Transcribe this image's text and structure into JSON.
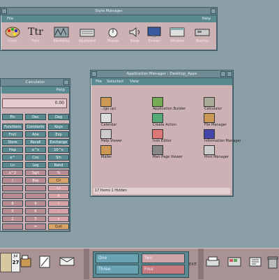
{
  "style_manager": {
    "title": "Style Manager",
    "menu": {
      "left": "File",
      "right": "Help"
    },
    "icons": [
      {
        "label": "Color",
        "icon": "palette-icon"
      },
      {
        "label": "Font",
        "icon": "font-icon"
      },
      {
        "label": "Backdrop",
        "icon": "backdrop-icon"
      },
      {
        "label": "Keyboard",
        "icon": "keyboard-icon"
      },
      {
        "label": "Mouse",
        "icon": "mouse-icon"
      },
      {
        "label": "Beep",
        "icon": "beep-icon"
      },
      {
        "label": "Screen",
        "icon": "screen-icon"
      },
      {
        "label": "Window",
        "icon": "window-icon"
      },
      {
        "label": "Startup",
        "icon": "startup-icon"
      }
    ],
    "font_glyph": "Ttr"
  },
  "calculator": {
    "title": "Calculator",
    "menu_help": "Help",
    "display": "0.00",
    "mode_row": [
      "Fin",
      "Dec",
      "Deg"
    ],
    "rows": [
      [
        "Functions",
        "Constants",
        "Keys"
      ],
      [
        "Fnct",
        "Ahe",
        "Exp"
      ],
      [
        "Store",
        "Recall",
        "Exchange"
      ],
      [
        "Hop",
        "e^x",
        "10^x"
      ],
      [
        "e^",
        "Cos",
        "Sin"
      ],
      [
        "Ln",
        "Log",
        "Rand"
      ],
      [
        "x^2",
        "Sqrt",
        "%"
      ],
      [
        ")",
        "Bsp",
        "Clr"
      ],
      [
        "",
        "",
        "+/-"
      ],
      [
        "",
        "",
        "X"
      ],
      [
        "8",
        "9",
        "/"
      ],
      [
        "5",
        "6",
        "-"
      ],
      [
        "2",
        "3",
        "+"
      ],
      [
        "",
        "=",
        "Quit"
      ]
    ]
  },
  "app_manager": {
    "title": "Application Manager - Desktop_Apps",
    "menu": [
      "File",
      "Selected",
      "View"
    ],
    "items": [
      {
        "label": "..(go up)",
        "icon": "folder-up-icon"
      },
      {
        "label": "Application Builder",
        "icon": "app-builder-icon"
      },
      {
        "label": "Calculator",
        "icon": "calculator-icon"
      },
      {
        "label": "Calendar",
        "icon": "calendar-icon"
      },
      {
        "label": "Create Action",
        "icon": "create-action-icon"
      },
      {
        "label": "File Manager",
        "icon": "file-manager-icon"
      },
      {
        "label": "Help Viewer",
        "icon": "help-icon"
      },
      {
        "label": "Icon Editor",
        "icon": "icon-editor-icon"
      },
      {
        "label": "Information Manager",
        "icon": "info-icon"
      },
      {
        "label": "Mailer",
        "icon": "mailer-icon"
      },
      {
        "label": "Man Page Viewer",
        "icon": "man-page-icon"
      },
      {
        "label": "Print Manager",
        "icon": "printer-icon"
      }
    ],
    "status": "17 Items 1 Hidden"
  },
  "front_panel": {
    "date": {
      "month": "Jul",
      "day": "27"
    },
    "workspaces": [
      {
        "label": "One",
        "color": "#6aa3b4"
      },
      {
        "label": "Two",
        "color": "#cda5a9"
      },
      {
        "label": "Three",
        "color": "#6aa3b4"
      },
      {
        "label": "Four",
        "color": "#c57a80"
      }
    ],
    "exit_label": "EXIT"
  }
}
